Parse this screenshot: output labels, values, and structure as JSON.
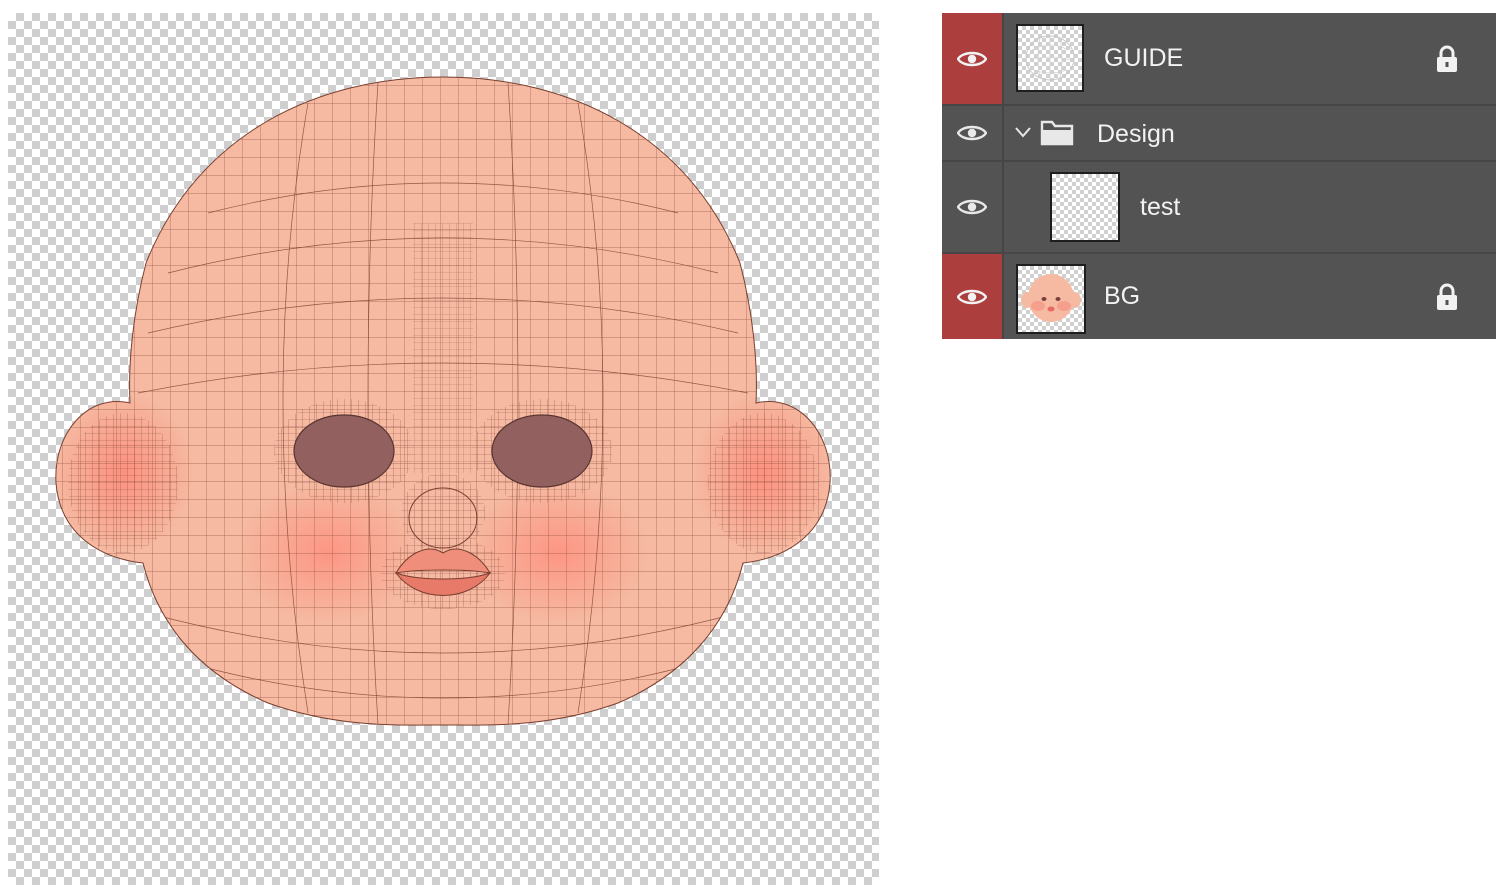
{
  "colors": {
    "panel_bg": "#535353",
    "panel_separator": "#464646",
    "locked_eye_bg": "#ac3e3e",
    "skin": "#f6b9a1",
    "wire": "#7a3e2e",
    "eye_hole": "#91605f",
    "lips": "#f08e7c"
  },
  "canvas": {
    "image_name": "uv-wireframe-face-icon"
  },
  "layers": [
    {
      "name": "GUIDE",
      "visible": true,
      "locked": true,
      "eye_icon": "eye-icon",
      "lock_icon": "lock-icon",
      "thumbnail": "guide-sketch-thumbnail"
    },
    {
      "name": "Design",
      "visible": true,
      "locked": false,
      "group": true,
      "expanded": true,
      "eye_icon": "eye-icon",
      "chevron_icon": "chevron-down-icon",
      "folder_icon": "folder-icon"
    },
    {
      "name": "test",
      "visible": true,
      "locked": false,
      "indent": 1,
      "eye_icon": "eye-icon",
      "thumbnail": "transparent-thumbnail"
    },
    {
      "name": "BG",
      "visible": true,
      "locked": true,
      "eye_icon": "eye-icon",
      "lock_icon": "lock-icon",
      "thumbnail": "face-thumbnail"
    }
  ]
}
